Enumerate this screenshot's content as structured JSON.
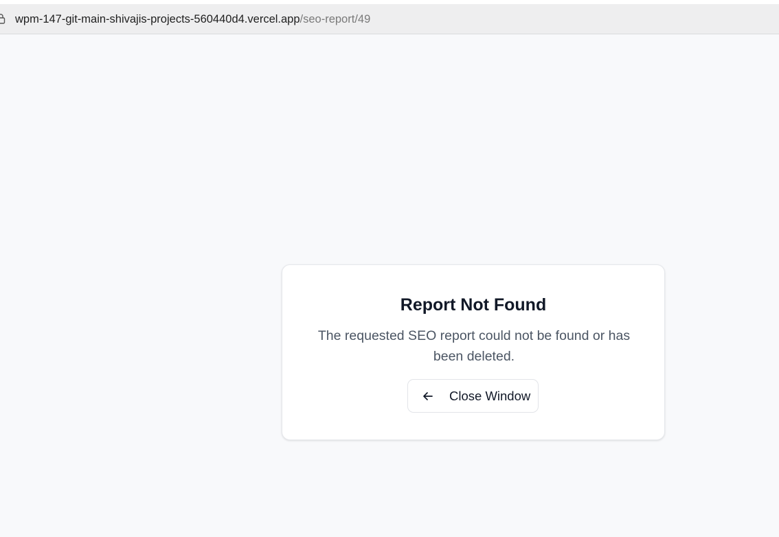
{
  "browser": {
    "url_host": "wpm-147-git-main-shivajis-projects-560440d4.vercel.app",
    "url_path": "/seo-report/49",
    "lock_icon": "lock-icon"
  },
  "card": {
    "title": "Report Not Found",
    "message": "The requested SEO report could not be found or has been deleted.",
    "button_label": "Close Window",
    "button_icon": "arrow-left-icon"
  }
}
